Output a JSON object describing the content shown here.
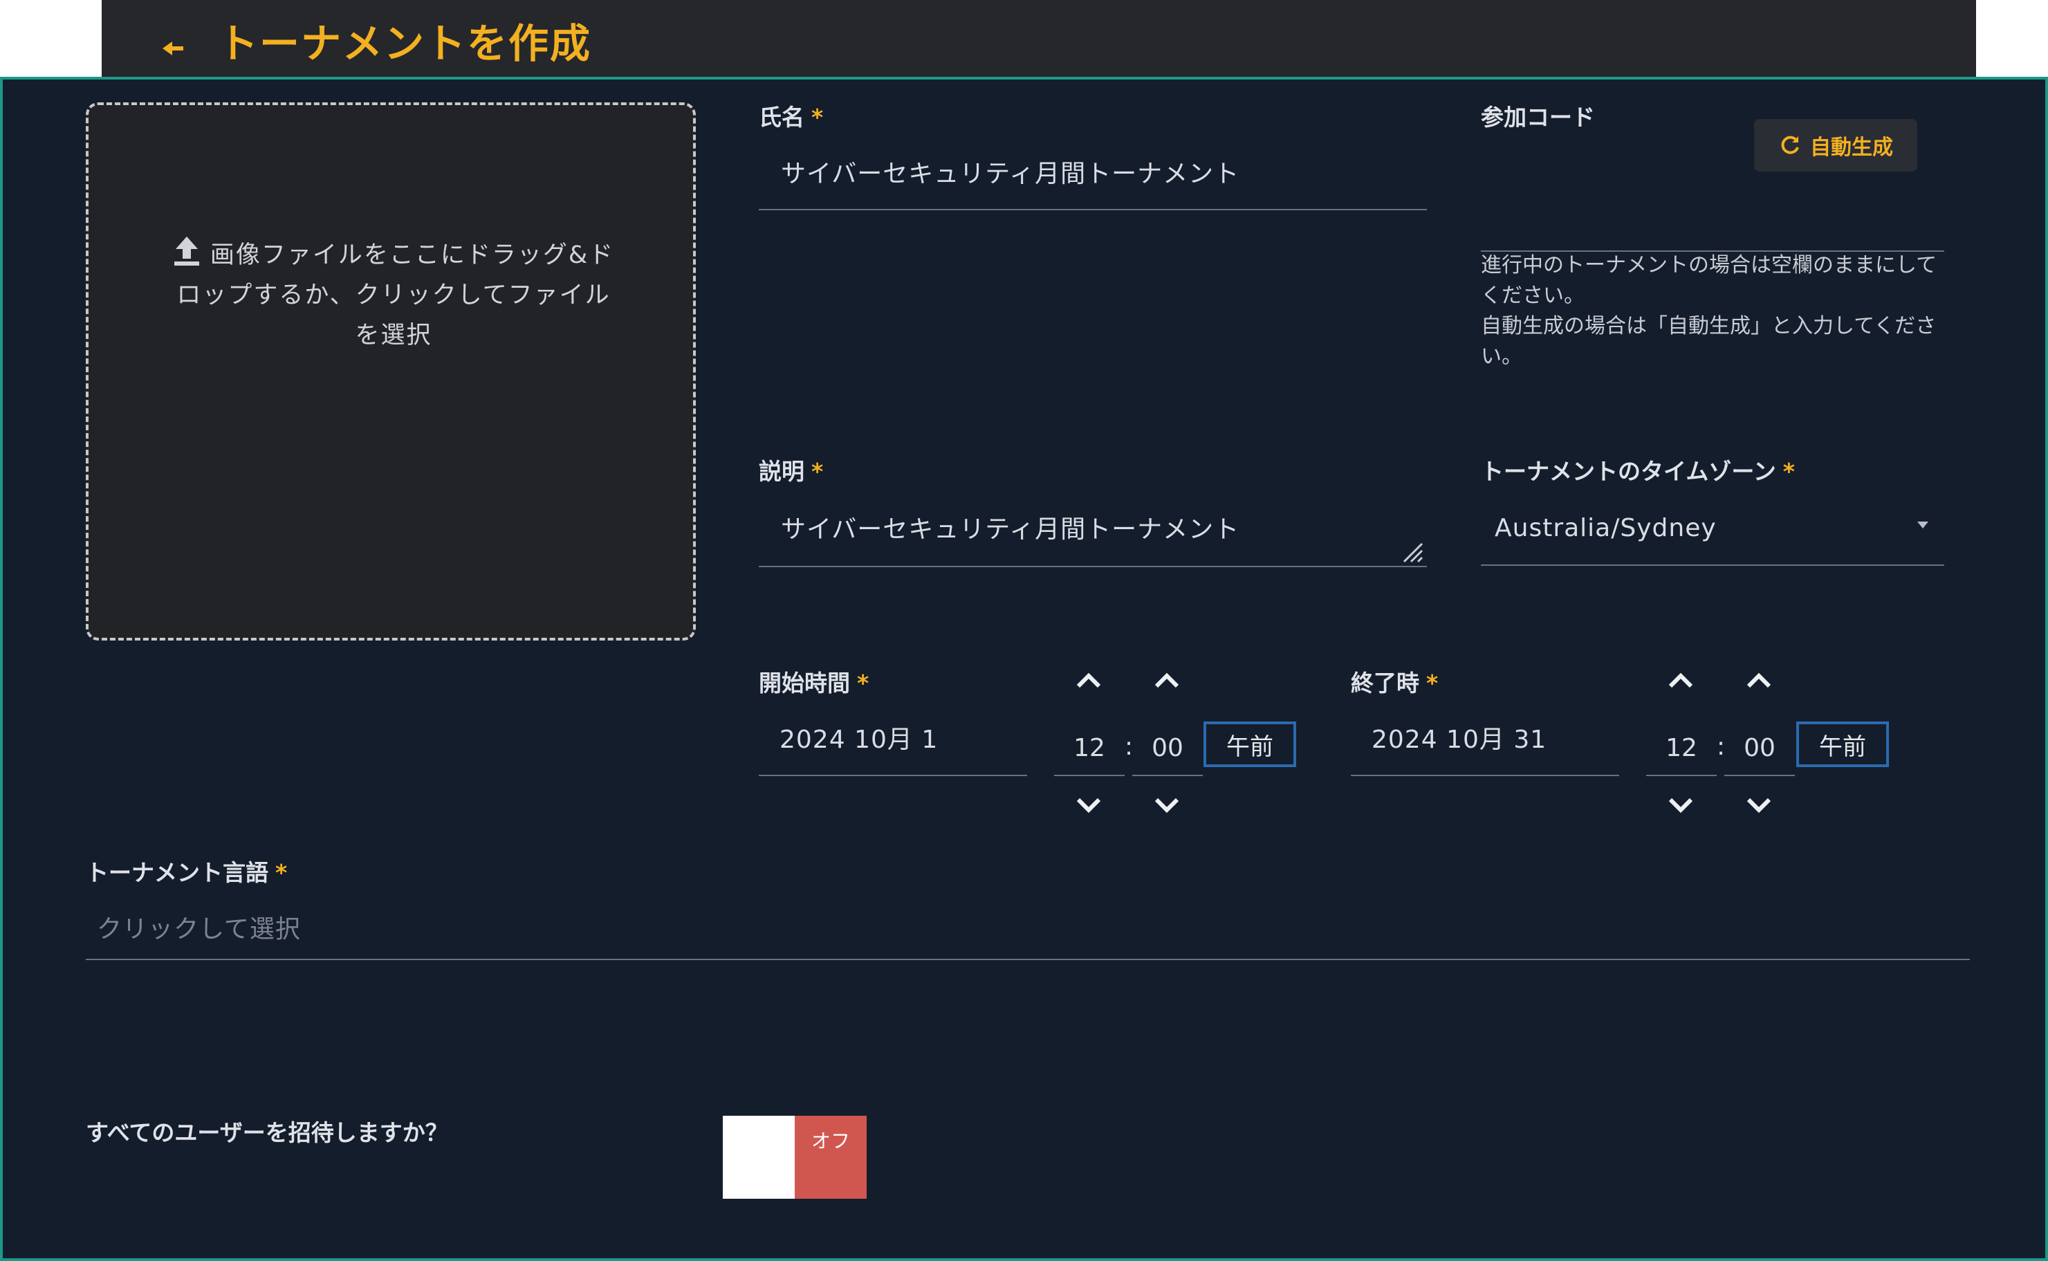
{
  "header": {
    "title": "トーナメントを作成"
  },
  "upload": {
    "text": "画像ファイルをここにドラッグ&ドロップするか、クリックしてファイルを選択"
  },
  "name": {
    "label": "氏名",
    "required": "*",
    "value": "サイバーセキュリティ月間トーナメント"
  },
  "join_code": {
    "label": "参加コード",
    "generate_label": "自動生成",
    "value": "",
    "hint_line1": "進行中のトーナメントの場合は空欄のままにしてください。",
    "hint_line2": "自動生成の場合は「自動生成」と入力してください。"
  },
  "description": {
    "label": "説明",
    "required": "*",
    "value": "サイバーセキュリティ月間トーナメント"
  },
  "timezone": {
    "label": "トーナメントのタイムゾーン",
    "required": "*",
    "value": "Australia/Sydney"
  },
  "start": {
    "label": "開始時間",
    "required": "*",
    "date": "2024 10月 1",
    "hour": "12",
    "minute": "00",
    "ampm": "午前"
  },
  "end": {
    "label": "終了時",
    "required": "*",
    "date": "2024 10月 31",
    "hour": "12",
    "minute": "00",
    "ampm": "午前"
  },
  "language": {
    "label": "トーナメント言語",
    "required": "*",
    "placeholder": "クリックして選択"
  },
  "invite": {
    "label": "すべてのユーザーを招待しますか？",
    "toggle_text": "オフ",
    "enabled": false
  },
  "colors": {
    "accent": "#f3b020",
    "panel_bg": "#141d2c",
    "toggle_off": "#d0574f",
    "ampm_border": "#2a6bb0"
  }
}
